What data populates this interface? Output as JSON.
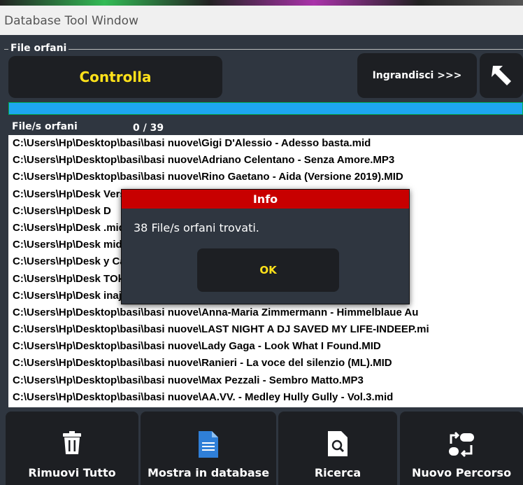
{
  "window": {
    "title": "Database Tool Window"
  },
  "group": {
    "label": "File orfani"
  },
  "toolbar": {
    "check_label": "Controlla",
    "enlarge_label": "Ingrandisci >>>",
    "back_icon": "back-arrow-icon"
  },
  "progress": {
    "value": 1.0,
    "color": "#1ea6f0"
  },
  "list": {
    "header": "File/s orfani",
    "count": "0 / 39",
    "rows": [
      "C:\\Users\\Hp\\Desktop\\basi\\basi nuove\\Gigi D'Alessio - Adesso basta.mid",
      "C:\\Users\\Hp\\Desktop\\basi\\basi nuove\\Adriano Celentano - Senza Amore.MP3",
      "C:\\Users\\Hp\\Desktop\\basi\\basi nuove\\Rino Gaetano - Aida (Versione 2019).MID",
      "C:\\Users\\Hp\\Desk                                                      Version).mid",
      "C:\\Users\\Hp\\Desk                                                      D",
      "C:\\Users\\Hp\\Desk                                                      .mid",
      "C:\\Users\\Hp\\Desk                                                      mid",
      "C:\\Users\\Hp\\Desk                                                      y Can I Move On).",
      "C:\\Users\\Hp\\Desk                                                      TOkaraoke.mp3",
      "C:\\Users\\Hp\\Desk                                                      inaj - Give me all",
      "C:\\Users\\Hp\\Desktop\\basi\\basi nuove\\Anna-Maria Zimmermann - Himmelblaue Au",
      "C:\\Users\\Hp\\Desktop\\basi\\basi nuove\\LAST NIGHT A DJ SAVED MY LIFE-INDEEP.mi",
      "C:\\Users\\Hp\\Desktop\\basi\\basi nuove\\Lady Gaga - Look What I Found.MID",
      "C:\\Users\\Hp\\Desktop\\basi\\basi nuove\\Ranieri - La voce del silenzio (ML).MID",
      "C:\\Users\\Hp\\Desktop\\basi\\basi nuove\\Max Pezzali - Sembro Matto.MP3",
      "C:\\Users\\Hp\\Desktop\\basi\\basi nuove\\AA.VV. - Medley Hully Gully - Vol.3.mid"
    ]
  },
  "bottom_buttons": {
    "remove_all": "Rimuovi Tutto",
    "show_db": "Mostra in database",
    "search": "Ricerca",
    "new_path": "Nuovo Percorso"
  },
  "dialog": {
    "title": "Info",
    "message": "38  File/s orfani trovati.",
    "ok_label": "OK"
  },
  "colors": {
    "accent_yellow": "#ffe11a",
    "dialog_red": "#c80000",
    "panel": "#2f3640"
  }
}
